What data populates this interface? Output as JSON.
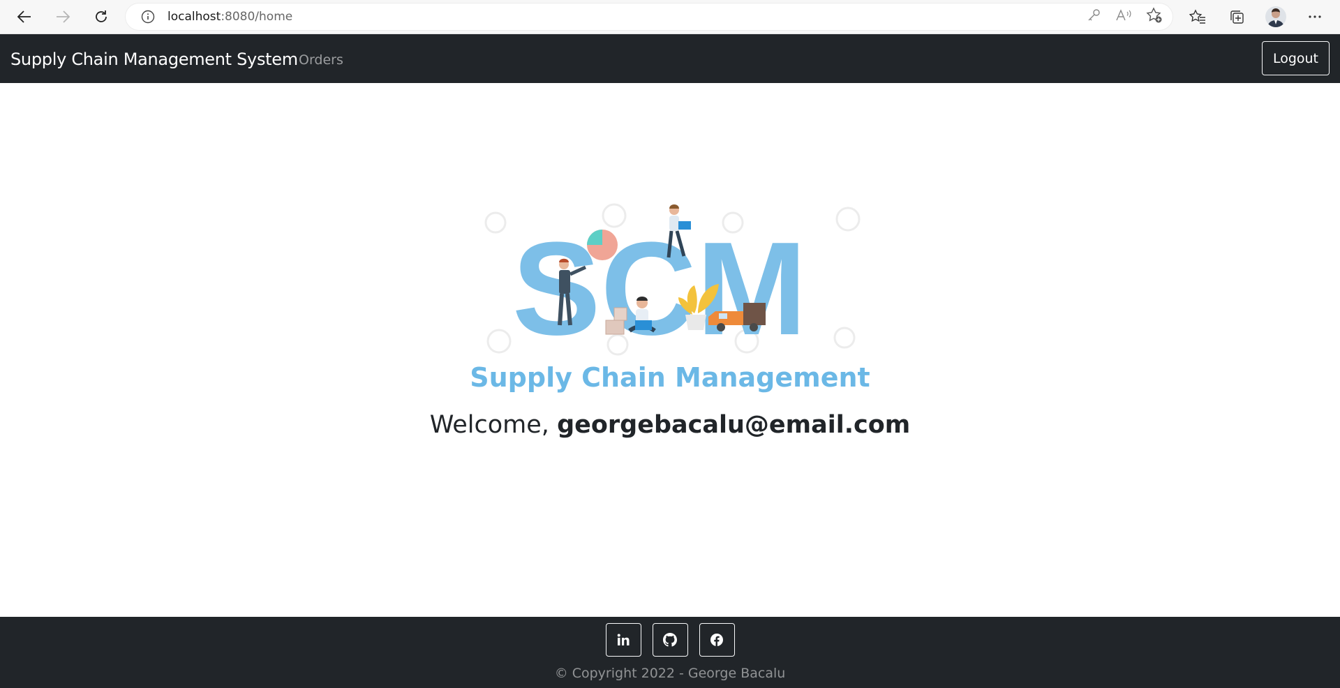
{
  "browser": {
    "url_host": "localhost",
    "url_rest": ":8080/home"
  },
  "navbar": {
    "brand": "Supply Chain Management System",
    "links": [
      {
        "label": "Orders"
      }
    ],
    "logout_label": "Logout"
  },
  "main": {
    "logo_letters": "SCM",
    "logo_caption": "Supply Chain Management",
    "welcome_prefix": "Welcome, ",
    "user_email": "georgebacalu@email.com"
  },
  "footer": {
    "social": [
      {
        "name": "linkedin",
        "glyph": "in"
      },
      {
        "name": "github",
        "glyph": "github-icon"
      },
      {
        "name": "facebook",
        "glyph": "facebook-icon"
      }
    ],
    "copyright": "© Copyright 2022 - George Bacalu"
  },
  "colors": {
    "navbar_bg": "#212529",
    "logo_blue": "#7dbfe8",
    "caption_blue": "#6bb8e6"
  }
}
